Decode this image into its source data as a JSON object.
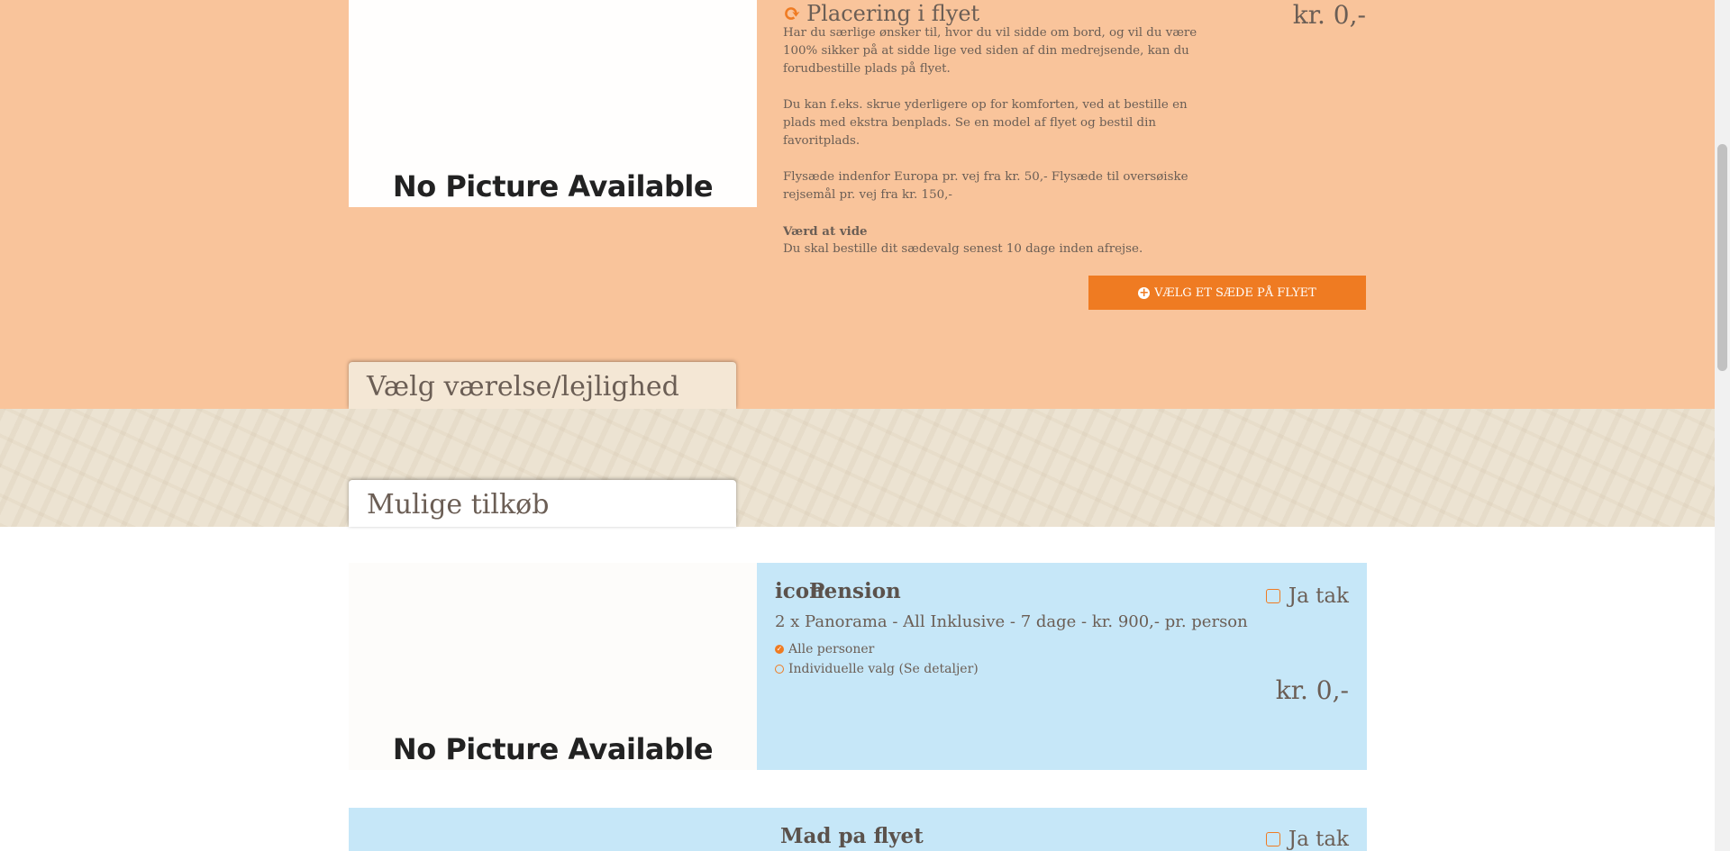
{
  "seat": {
    "title": "Placering i flyet",
    "icon": "refresh-icon",
    "image_placeholder": "No Picture Available",
    "paragraphs": [
      "Har du særlige ønsker til, hvor du vil sidde om bord, og vil du være 100% sikker på at sidde lige ved siden af din medrejsende, kan du forudbestille plads på flyet.",
      "Du kan f.eks. skrue yderligere op for komforten, ved at bestille en plads med ekstra benplads. Se en model af flyet og bestil din favoritplads.",
      "Flysæde indenfor Europa pr. vej fra kr. 50,- Flysæde til oversøiske rejsemål pr. vej fra kr. 150,-"
    ],
    "know_heading": "Værd at vide",
    "know_text": "Du skal bestille dit sædevalg senest 10 dage inden afrejse.",
    "price": "kr. 0,-",
    "button_label": "Vælg et sæde på flyet"
  },
  "tabs": {
    "room": "Vælg værelse/lejlighed",
    "extras": "Mulige tilkøb"
  },
  "pension": {
    "image_placeholder": "No Picture Available",
    "icon_text": "icon",
    "title": "Pension",
    "subtitle": "2 x Panorama - All Inklusive - 7 dage - kr. 900,- pr. person",
    "options": [
      "Alle personer",
      "Individuelle valg (Se detaljer)"
    ],
    "checkbox_label": "Ja tak",
    "price": "kr. 0,-"
  },
  "meal": {
    "title": "Mad pa flyet",
    "checkbox_label": "Ja tak"
  },
  "colors": {
    "orange_bg": "#f9c49b",
    "accent": "#ef7b22",
    "blue_card": "#c6e7f8",
    "sand": "#ece3d2"
  }
}
